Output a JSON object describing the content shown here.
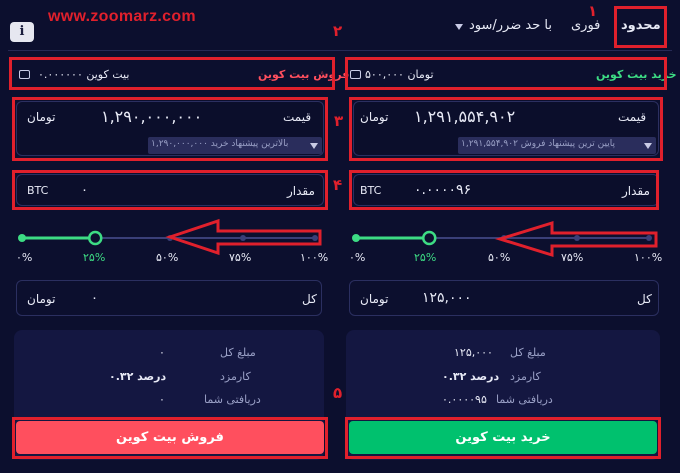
{
  "watermark": "www.zoomarz.com",
  "tabs": {
    "limit": "محدود",
    "instant": "فوری",
    "stop": "با حد ضرر/سود"
  },
  "info_label": "i",
  "annotations": {
    "n1": "۱",
    "n2": "۲",
    "n3": "۳",
    "n4": "۴",
    "n5": "۵"
  },
  "buy": {
    "title": "خرید بیت کوین",
    "balance": "۵۰۰,۰۰۰ تومان",
    "price_label": "قیمت",
    "price_value": "۱,۲۹۱,۵۵۴,۹۰۲",
    "price_unit": "تومان",
    "hint": "پایین ترین پیشنهاد فروش ۱,۲۹۱,۵۵۴,۹۰۲",
    "amount_label": "مقدار",
    "amount_value": "۰.۰۰۰۰۹۶",
    "amount_unit": "BTC",
    "slider_level": 0.25,
    "slider_ticks": [
      "۰%",
      "۲۵%",
      "۵۰%",
      "۷۵%",
      "۱۰۰%"
    ],
    "total_label": "کل",
    "total_value": "۱۲۵,۰۰۰",
    "total_unit": "تومان",
    "summary": {
      "total_label": "مبلغ کل",
      "total_value": "۱۲۵,۰۰۰",
      "fee_label": "کارمزد",
      "fee_value": "۰.۳۲ درصد",
      "receive_label": "دریافتی شما",
      "receive_value": "۰.۰۰۰۰۹۵"
    },
    "button": "خرید بیت کوین"
  },
  "sell": {
    "title": "فروش بیت کوین",
    "balance": "۰.۰۰۰۰۰۰ بیت کوین",
    "price_label": "قیمت",
    "price_value": "۱,۲۹۰,۰۰۰,۰۰۰",
    "price_unit": "تومان",
    "hint": "بالاترین پیشنهاد خرید ۱,۲۹۰,۰۰۰,۰۰۰",
    "amount_label": "مقدار",
    "amount_value": "۰",
    "amount_unit": "BTC",
    "slider_level": 0.25,
    "slider_ticks": [
      "۰%",
      "۲۵%",
      "۵۰%",
      "۷۵%",
      "۱۰۰%"
    ],
    "total_label": "کل",
    "total_value": "۰",
    "total_unit": "تومان",
    "summary": {
      "total_label": "مبلغ کل",
      "total_value": "۰",
      "fee_label": "کارمزد",
      "fee_value": "۰.۳۲ درصد",
      "receive_label": "دریافتی شما",
      "receive_value": "۰"
    },
    "button": "فروش بیت کوین"
  },
  "colors": {
    "background": "#0c0f2e",
    "panel": "#141741",
    "buy_green": "#00c16e",
    "sell_red": "#ff4f5e",
    "annotation_red": "#e0202c"
  }
}
